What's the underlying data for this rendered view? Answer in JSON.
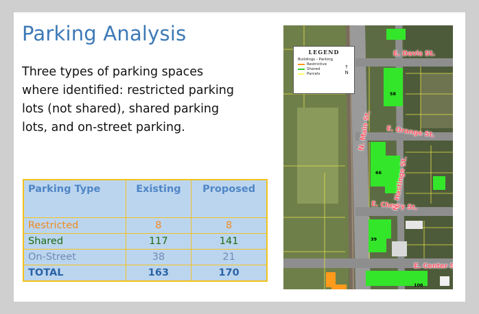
{
  "slide": {
    "title": "Parking Analysis",
    "body": "Three types of parking spaces where identified: restricted parking lots (not shared), shared parking lots, and on-street parking."
  },
  "table": {
    "headers": [
      "Parking Type",
      "Existing",
      "Proposed"
    ],
    "rows": [
      {
        "type": "Restricted",
        "existing": "8",
        "proposed": "8",
        "color": "#ef8a1f"
      },
      {
        "type": "Shared",
        "existing": "117",
        "proposed": "141",
        "color": "#1b6b12"
      },
      {
        "type": "On-Street",
        "existing": "38",
        "proposed": "21",
        "color": "#6b8cb4"
      },
      {
        "type": "TOTAL",
        "existing": "163",
        "proposed": "170",
        "color": "#2a63a6"
      }
    ]
  },
  "map": {
    "legend": {
      "title": "LEGEND",
      "group": "Buildings - Parking",
      "items": [
        {
          "label": "Restrictive",
          "color": "#ff9900"
        },
        {
          "label": "Shared",
          "color": "#33cc33"
        },
        {
          "label": "Parcels",
          "color": "#ffff66"
        }
      ],
      "north": "N"
    },
    "streets": {
      "davis": "E. Davis St.",
      "orange": "E. Orange St.",
      "cherry": "E. Cherry St.",
      "center": "E. Center St.",
      "main": "N. Main St.",
      "hastings": "N. Hastings St."
    },
    "building_labels": [
      "58",
      "66",
      "39",
      "106"
    ]
  }
}
